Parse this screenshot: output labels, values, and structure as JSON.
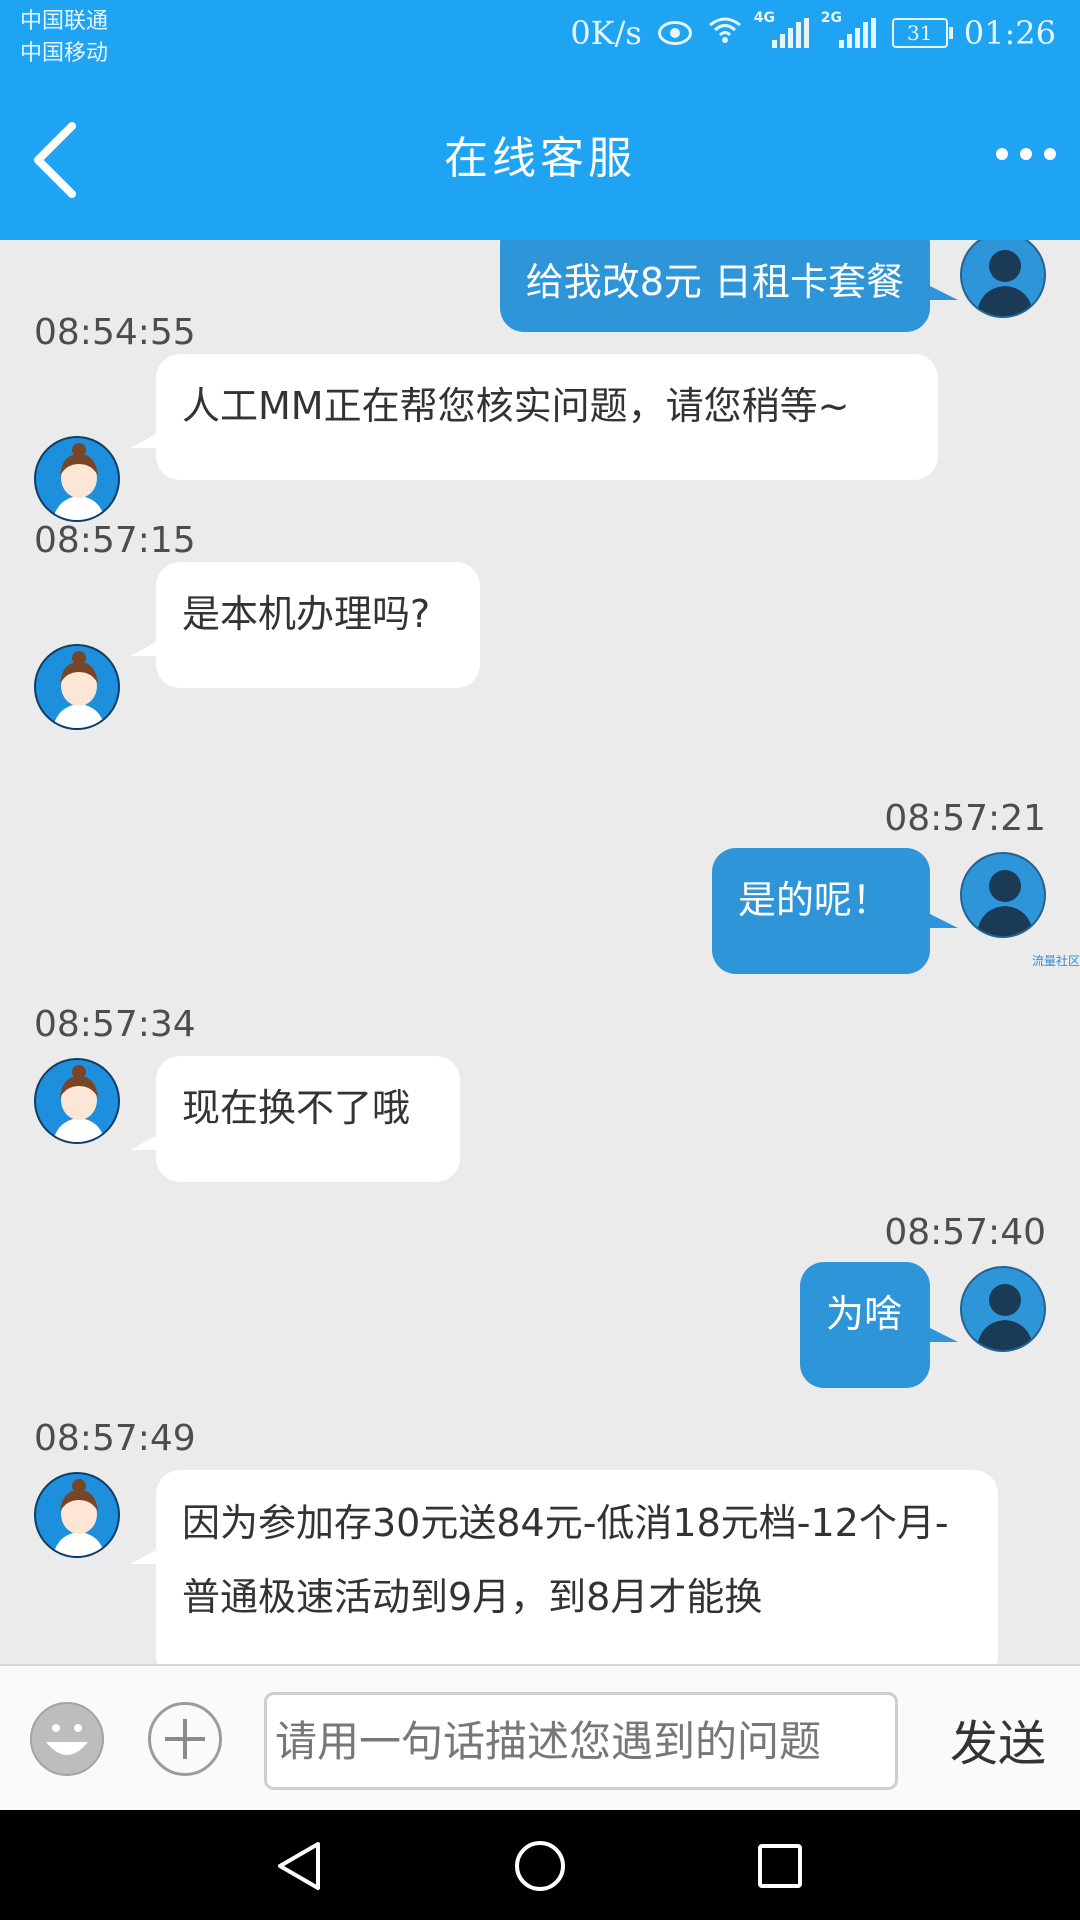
{
  "status_bar": {
    "carrier1": "中国联通",
    "carrier2": "中国移动",
    "net_speed": "0K/s",
    "signal1_label": "4G",
    "signal2_label": "2G",
    "battery": "31",
    "time": "01:26"
  },
  "header": {
    "title": "在线客服"
  },
  "messages": [
    {
      "from": "user",
      "text": "给我改8元 日租卡套餐"
    },
    {
      "from": "agent",
      "time": "08:54:55",
      "text": "人工MM正在帮您核实问题，请您稍等~"
    },
    {
      "from": "agent",
      "time": "08:57:15",
      "text": "是本机办理吗?"
    },
    {
      "from": "user",
      "time": "08:57:21",
      "text": "是的呢！"
    },
    {
      "from": "agent",
      "time": "08:57:34",
      "text": "现在换不了哦"
    },
    {
      "from": "user",
      "time": "08:57:40",
      "text": "为啥"
    },
    {
      "from": "agent",
      "time": "08:57:49",
      "text": "因为参加存30元送84元-低消18元档-12个月-普通极速活动到9月，到8月才能换"
    }
  ],
  "watermark": "流量社区",
  "input_bar": {
    "placeholder": "请用一句话描述您遇到的问题",
    "value": "",
    "send_label": "发送"
  },
  "icons": {
    "back": "chevron-left-icon",
    "more": "more-dots-icon",
    "emoji": "emoji-icon",
    "plus": "plus-icon"
  },
  "colors": {
    "header_blue": "#1fa3f3",
    "user_bubble": "#2f95d9",
    "chat_background": "#ebebeb"
  }
}
